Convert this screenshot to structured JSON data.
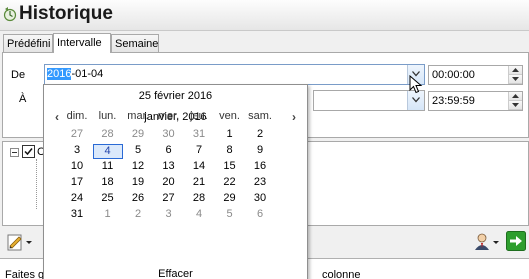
{
  "app": {
    "title": "Historique"
  },
  "tabs": [
    {
      "label": "Prédéfini",
      "active": false
    },
    {
      "label": "Intervalle",
      "active": true
    },
    {
      "label": "Semaine",
      "active": false
    }
  ],
  "range": {
    "from_label": "De",
    "to_label": "À",
    "from_date_selected": "2016",
    "from_date_rest": "-01-04",
    "from_time": "00:00:00",
    "to_time": "23:59:59"
  },
  "calendar": {
    "today_label": "25 février 2016",
    "month_label": "janvier, 2016",
    "prev_icon": "chevron-left-icon",
    "next_icon": "chevron-right-icon",
    "weekdays": [
      "dim.",
      "lun.",
      "mar.",
      "mer.",
      "jeu.",
      "ven.",
      "sam."
    ],
    "weeks": [
      [
        {
          "d": "27",
          "o": true
        },
        {
          "d": "28",
          "o": true
        },
        {
          "d": "29",
          "o": true
        },
        {
          "d": "30",
          "o": true
        },
        {
          "d": "31",
          "o": true
        },
        {
          "d": "1"
        },
        {
          "d": "2"
        }
      ],
      [
        {
          "d": "3"
        },
        {
          "d": "4",
          "s": true
        },
        {
          "d": "5"
        },
        {
          "d": "6"
        },
        {
          "d": "7"
        },
        {
          "d": "8"
        },
        {
          "d": "9"
        }
      ],
      [
        {
          "d": "10"
        },
        {
          "d": "11"
        },
        {
          "d": "12"
        },
        {
          "d": "13"
        },
        {
          "d": "14"
        },
        {
          "d": "15"
        },
        {
          "d": "16"
        }
      ],
      [
        {
          "d": "17"
        },
        {
          "d": "18"
        },
        {
          "d": "19"
        },
        {
          "d": "20"
        },
        {
          "d": "21"
        },
        {
          "d": "22"
        },
        {
          "d": "23"
        }
      ],
      [
        {
          "d": "24"
        },
        {
          "d": "25"
        },
        {
          "d": "26"
        },
        {
          "d": "27"
        },
        {
          "d": "28"
        },
        {
          "d": "29"
        },
        {
          "d": "30"
        }
      ],
      [
        {
          "d": "31"
        },
        {
          "d": "1",
          "o": true
        },
        {
          "d": "2",
          "o": true
        },
        {
          "d": "3",
          "o": true
        },
        {
          "d": "4",
          "o": true
        },
        {
          "d": "5",
          "o": true
        },
        {
          "d": "6",
          "o": true
        }
      ]
    ],
    "clear_label": "Effacer"
  },
  "tree": {
    "root_label": "C"
  },
  "status": {
    "left": "Faites g",
    "right": "colonne"
  },
  "colors": {
    "accent": "#3399ff",
    "go_arrow": "#2e9e2e"
  }
}
